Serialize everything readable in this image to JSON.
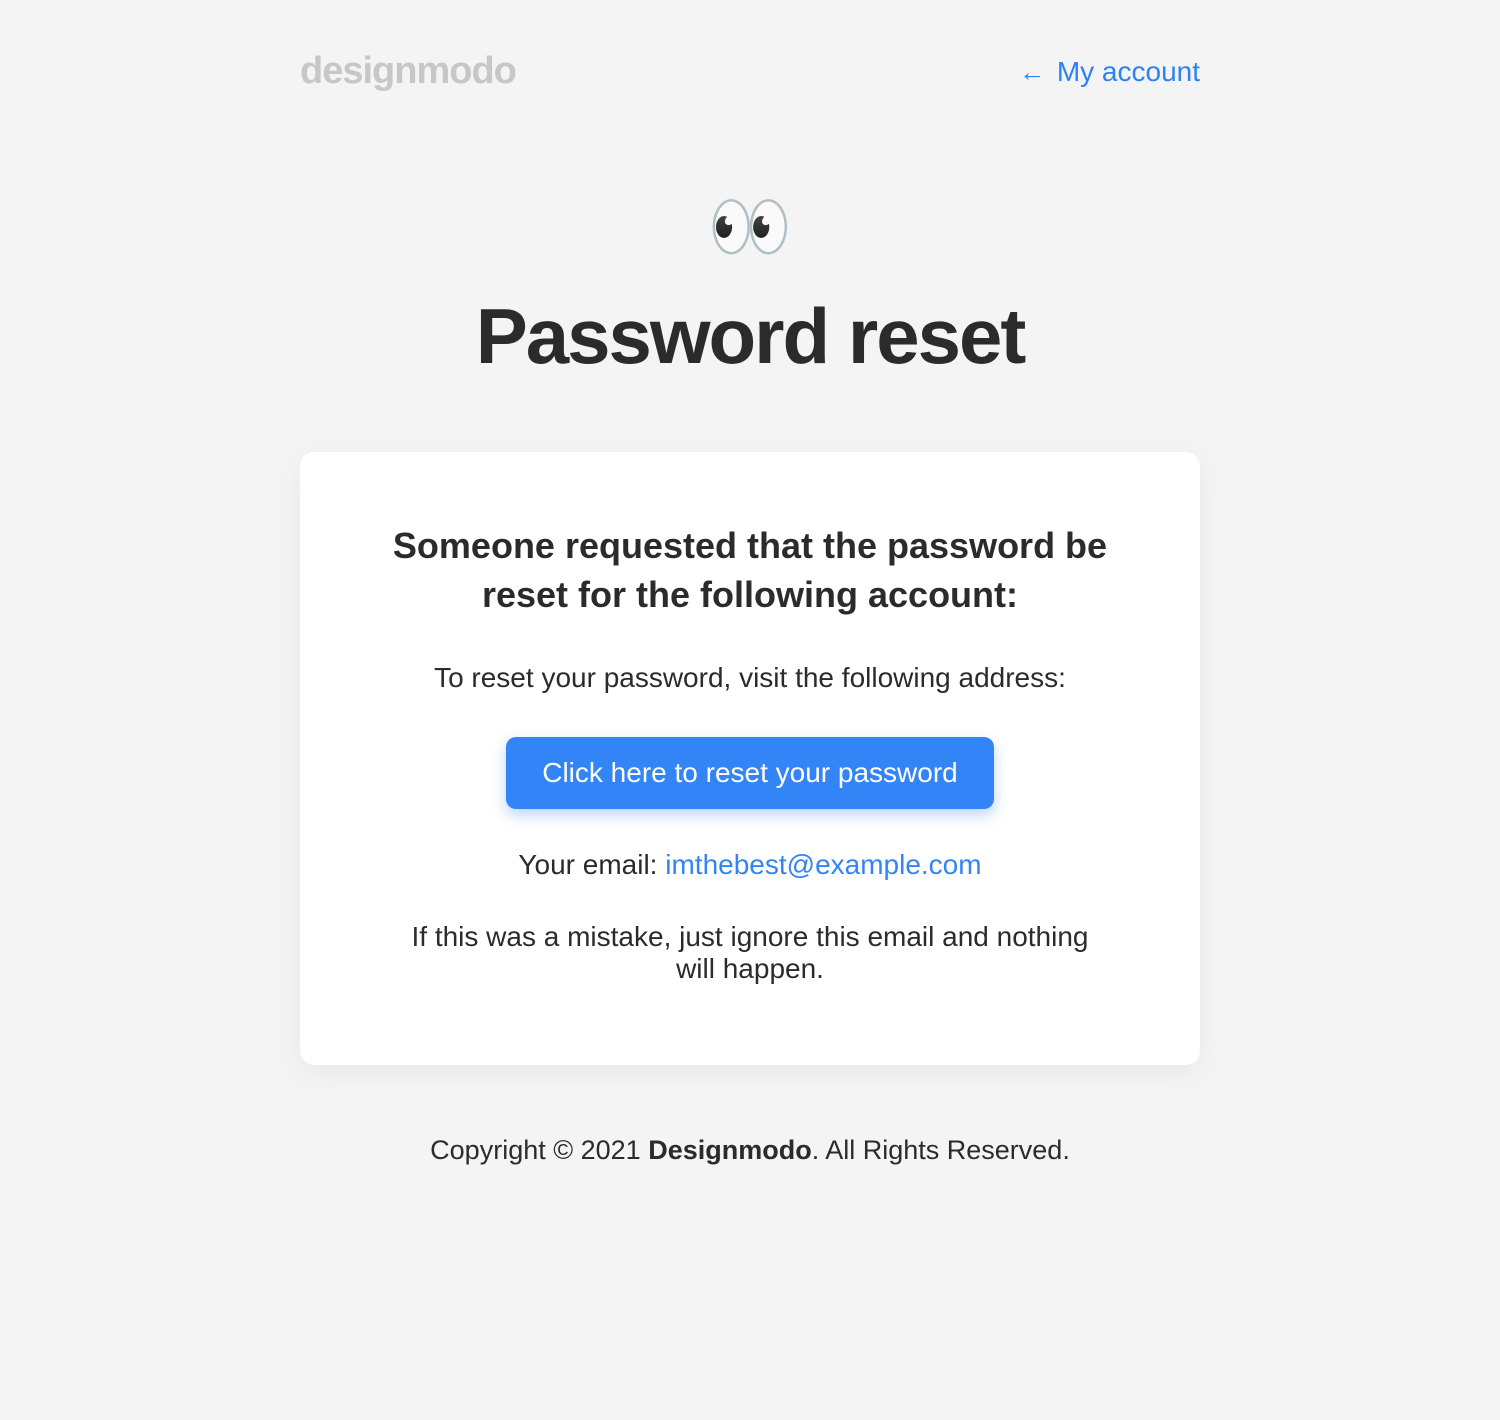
{
  "header": {
    "logo_text": "designmodo",
    "account_link_arrow": "←",
    "account_link_text": " My account"
  },
  "hero": {
    "icon": "👀",
    "title": "Password reset"
  },
  "card": {
    "heading": "Someone requested that the password be reset for the following account:",
    "instruction": "To reset your password, visit the following address:",
    "button_label": "Click here to reset your password",
    "email_label": "Your email: ",
    "email_value": "imthebest@example.com",
    "mistake_text": "If this was a mistake, just ignore this email and nothing will happen."
  },
  "footer": {
    "prefix": "Copyright © 2021 ",
    "brand": "Designmodo",
    "suffix": ". All Rights Reserved."
  }
}
